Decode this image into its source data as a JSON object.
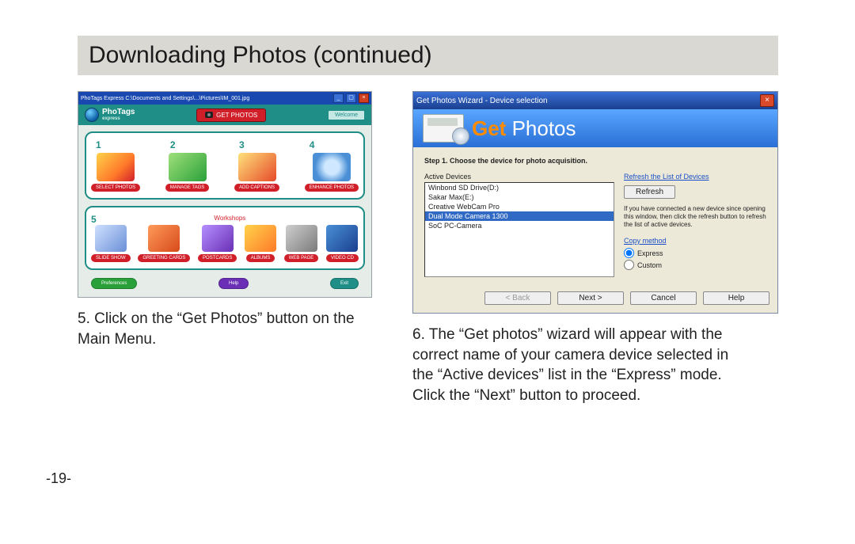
{
  "page": {
    "title": "Downloading Photos (continued)",
    "page_number": "-19-"
  },
  "left": {
    "caption": "5. Click on the “Get Photos” button on the Main Menu.",
    "window": {
      "titlebar": "PhoTags Express  C:\\Documents and Settings\\...\\Pictures\\IM_001.jpg",
      "logo_line1": "PhoTags",
      "logo_line2": "express",
      "get_photos_btn": "GET PHOTOS",
      "welcome_btn": "Welcome",
      "section2_title": "Workshops",
      "tiles_top": [
        {
          "num": "1",
          "label": "SELECT PHOTOS"
        },
        {
          "num": "2",
          "label": "MANAGE TAGS"
        },
        {
          "num": "3",
          "label": "ADD CAPTIONS"
        },
        {
          "num": "4",
          "label": "ENHANCE PHOTOS"
        }
      ],
      "tiles_bottom_num": "5",
      "tiles_bottom": [
        {
          "label": "SLIDE SHOW"
        },
        {
          "label": "GREETING CARDS"
        },
        {
          "label": "POSTCARDS"
        },
        {
          "label": "ALBUMS"
        },
        {
          "label": "WEB PAGE"
        },
        {
          "label": "VIDEO CD"
        }
      ],
      "bottom_buttons": {
        "left": "Preferences",
        "mid": "Help",
        "right": "Exit"
      }
    }
  },
  "right": {
    "caption": "6. The “Get photos” wizard will appear with the correct name of your camera device selected in the “Active devices” list in the “Express” mode. Click the “Next” button to proceed.",
    "window": {
      "titlebar": "Get Photos Wizard - Device selection",
      "banner_get": "Get",
      "banner_photos": " Photos",
      "step": "Step 1. Choose the device for photo acquisition.",
      "active_label": "Active Devices",
      "devices": [
        "Winbond SD Drive(D:)",
        "Sakar Max(E:)",
        "Creative WebCam Pro",
        "Dual Mode Camera 1300",
        "SoC PC-Camera"
      ],
      "selected_index": 3,
      "refresh_link": "Refresh the List of Devices",
      "refresh_btn": "Refresh",
      "hint": "If you have connected a new device since opening this window, then click the refresh button to refresh the list of active devices.",
      "copy_label": "Copy method",
      "radio_express": "Express",
      "radio_custom": "Custom",
      "buttons": {
        "back": "< Back",
        "next": "Next >",
        "cancel": "Cancel",
        "help": "Help"
      }
    }
  }
}
